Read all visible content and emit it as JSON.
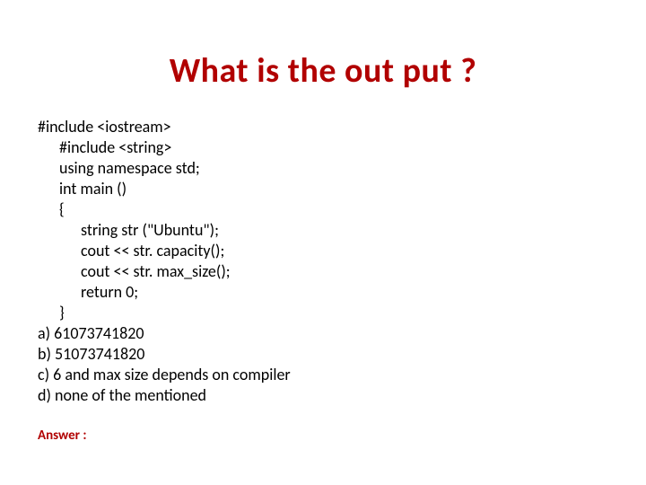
{
  "title": "What is the out put ?",
  "code": {
    "l1": "#include <iostream>",
    "l2": "#include <string>",
    "l3": "using namespace std;",
    "l4": "int main ()",
    "l5": "{",
    "l6": "string str (\"Ubuntu\");",
    "l7": "cout << str. capacity();",
    "l8": "cout << str. max_size();",
    "l9": "return 0;",
    "l10": "}"
  },
  "options": {
    "a": "a) 61073741820",
    "b": "b) 51073741820",
    "c": "c) 6 and max size depends on compiler",
    "d": "d) none of the mentioned"
  },
  "answer_label": "Answer :"
}
